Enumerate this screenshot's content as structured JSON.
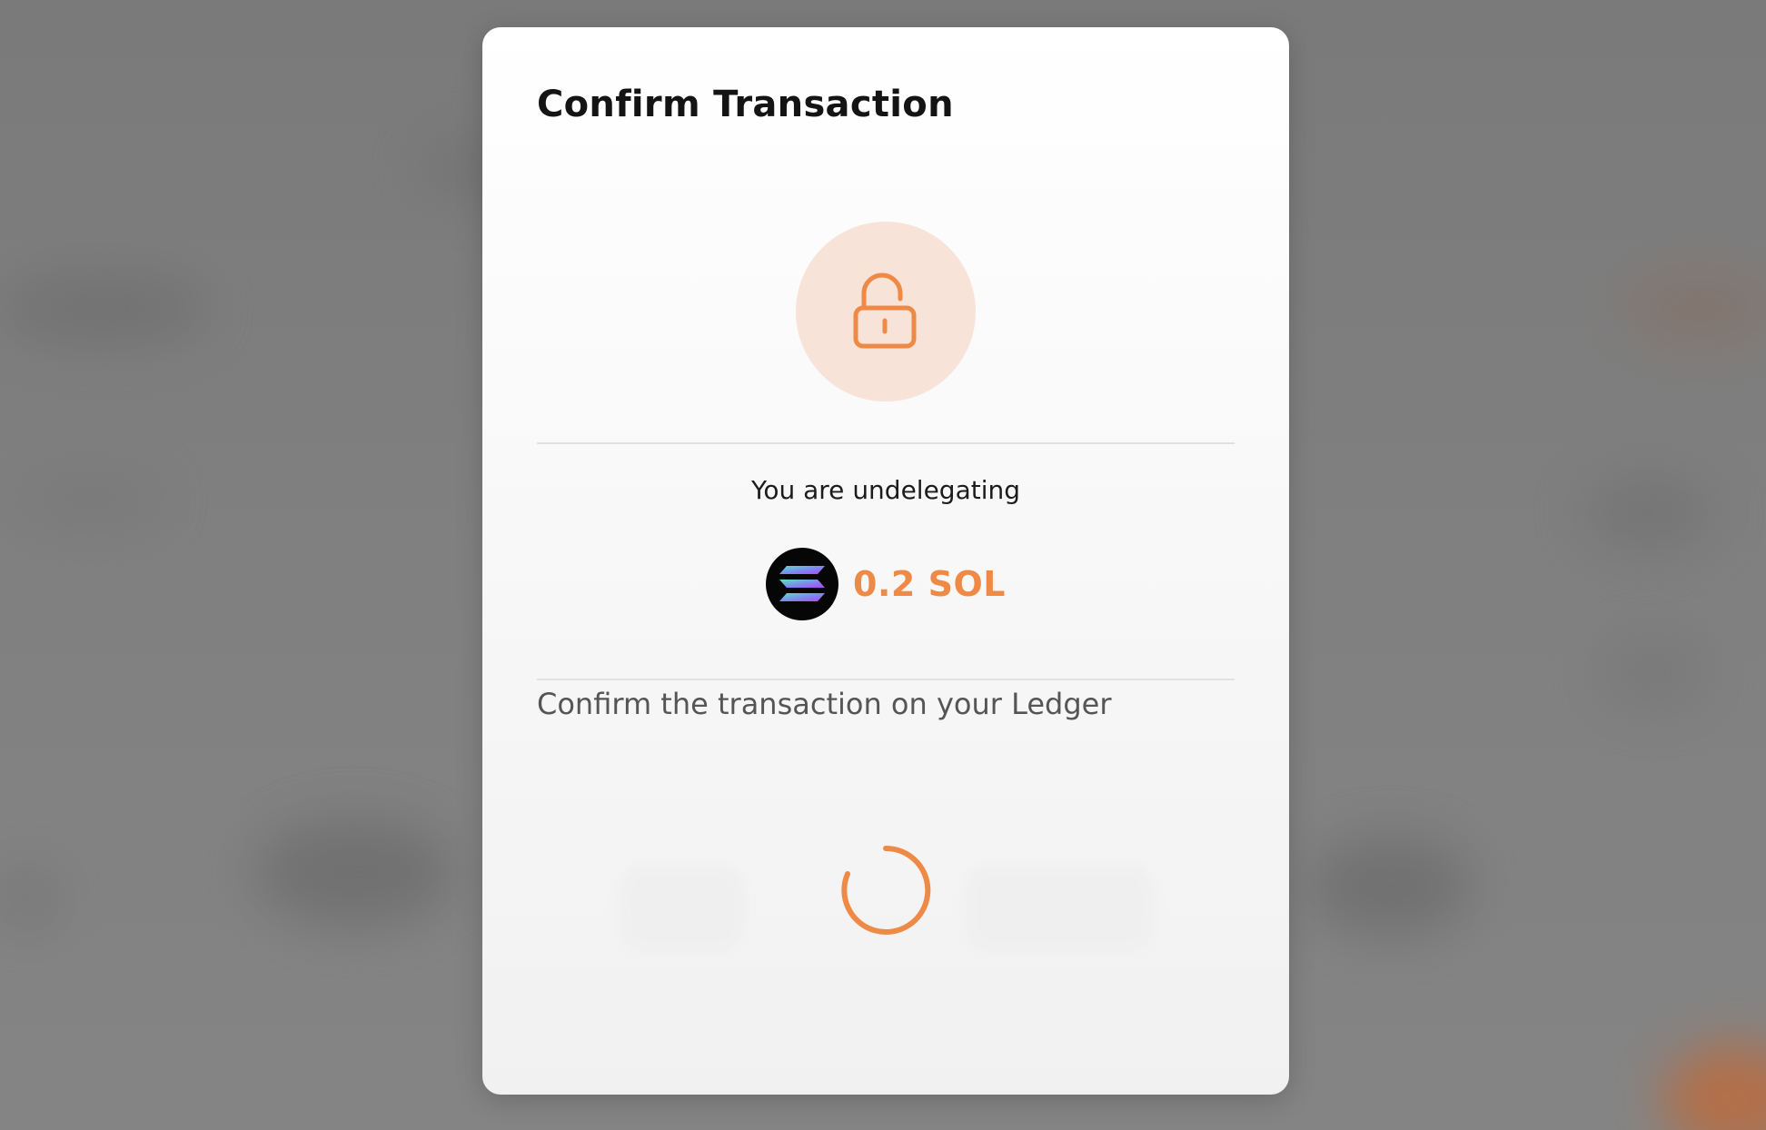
{
  "modal": {
    "title": "Confirm Transaction",
    "icon": "unlock-icon",
    "action_text": "You are undelegating",
    "amount": "0.2 SOL",
    "token_logo": "solana-logo",
    "instruction": "Confirm the transaction on your Ledger",
    "loading_indicator": "spinner-icon"
  },
  "colors": {
    "accent": "#ee8a45",
    "icon_circle_bg": "#f8e3d8",
    "overlay": "#7f7f7f",
    "modal_bg": "#ffffff"
  }
}
